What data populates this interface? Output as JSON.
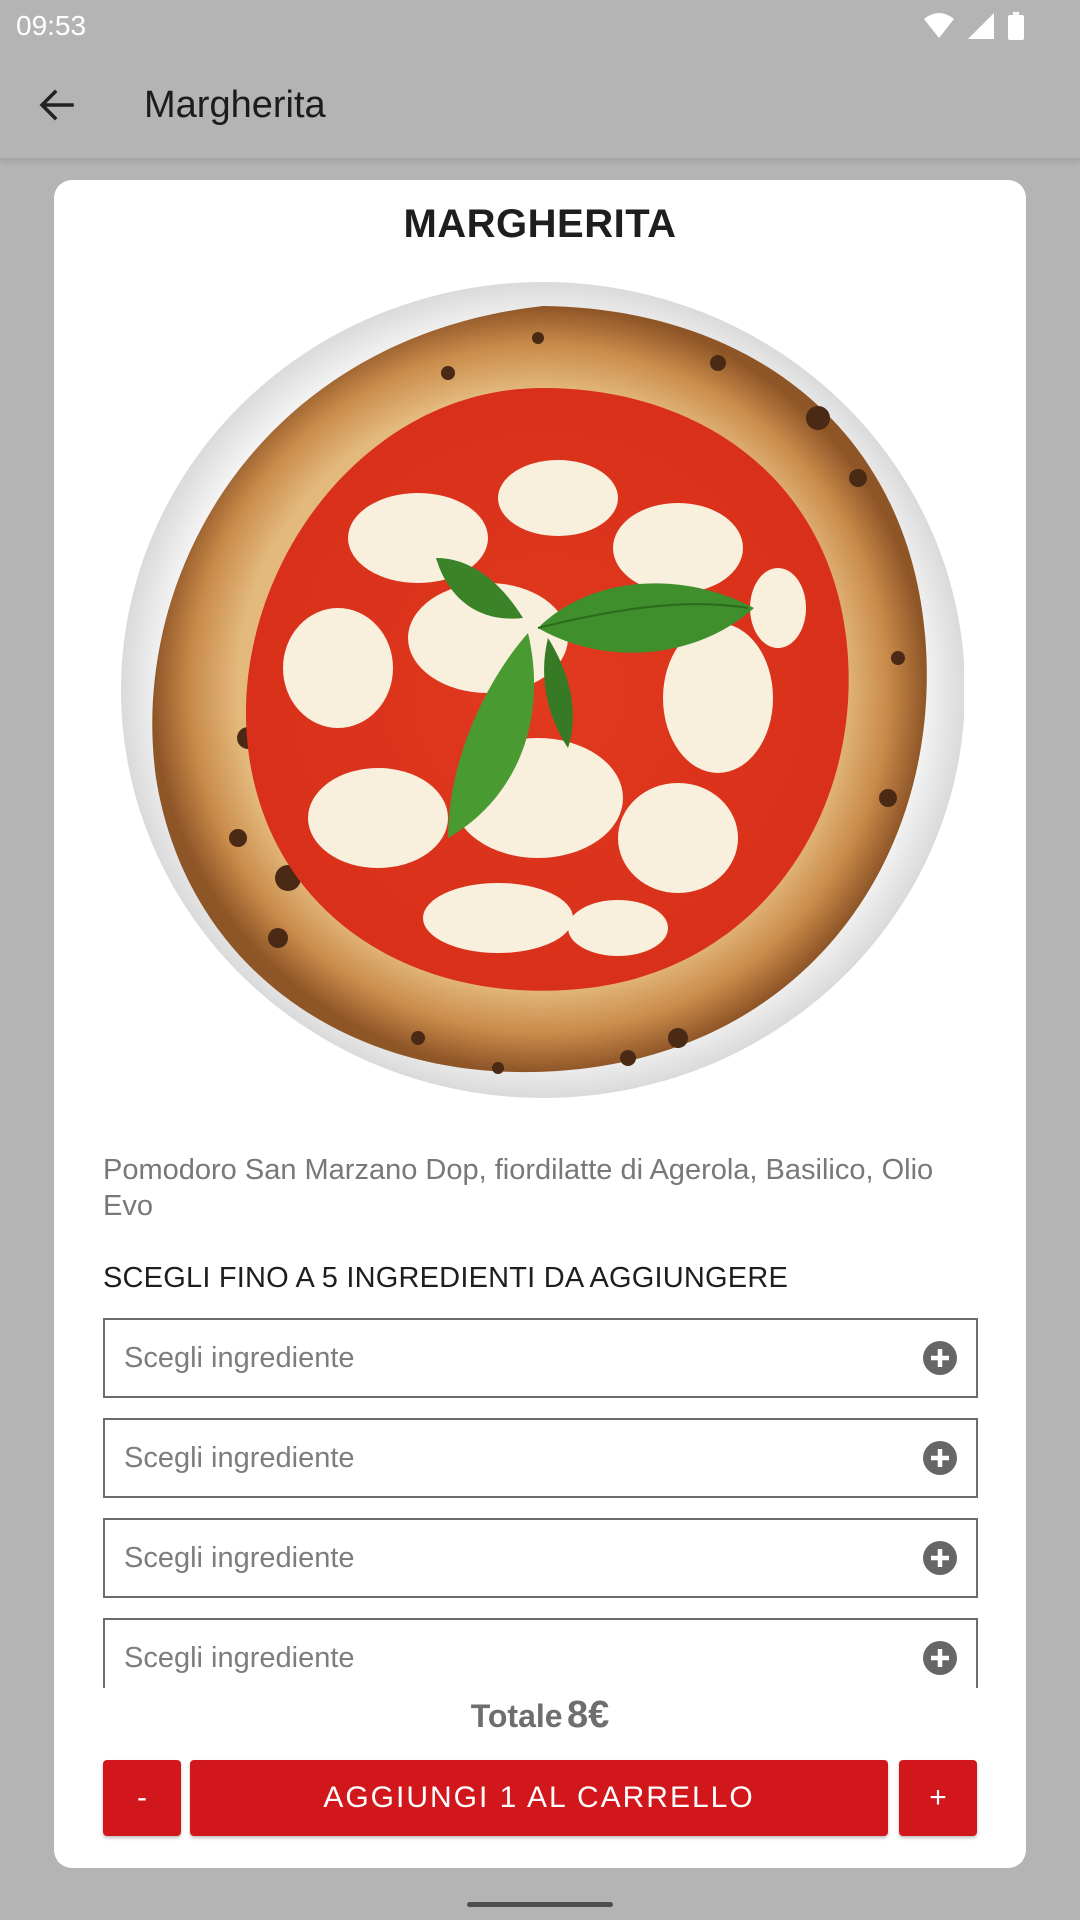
{
  "status_bar": {
    "time": "09:53",
    "icons": [
      "wifi-icon",
      "signal-icon",
      "battery-icon"
    ]
  },
  "app_bar": {
    "title": "Margherita",
    "back_icon": "arrow-left-icon"
  },
  "product": {
    "name": "MARGHERITA",
    "image": "pizza-margherita-photo",
    "description": "Pomodoro San Marzano Dop, fiordilatte di Agerola, Basilico, Olio Evo"
  },
  "ingredients": {
    "section_label": "SCEGLI FINO A 5 INGREDIENTI DA AGGIUNGERE",
    "slots": [
      {
        "placeholder": "Scegli ingrediente",
        "icon": "plus-circle-icon"
      },
      {
        "placeholder": "Scegli ingrediente",
        "icon": "plus-circle-icon"
      },
      {
        "placeholder": "Scegli ingrediente",
        "icon": "plus-circle-icon"
      },
      {
        "placeholder": "Scegli ingrediente",
        "icon": "plus-circle-icon"
      }
    ]
  },
  "cart": {
    "total_label": "Totale",
    "total_value": "8€",
    "minus_label": "-",
    "add_label": "AGGIUNGI 1 AL CARRELLO",
    "plus_label": "+"
  },
  "colors": {
    "accent": "#d2171c",
    "overlay_background": "#b4b4b4",
    "card_background": "#ffffff"
  }
}
